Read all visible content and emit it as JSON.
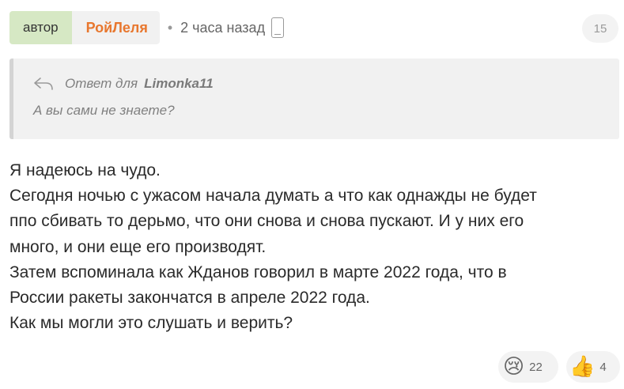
{
  "comment": {
    "author_tag": "автор",
    "author_name": "РойЛеля",
    "separator": "•",
    "time": "2 часа назад",
    "device_icon": "phone-icon",
    "rating": "15"
  },
  "quote": {
    "prefix": "Ответ для",
    "user": "Limonka11",
    "text": "А вы сами не знаете?",
    "icon": "reply-icon"
  },
  "body": {
    "lines": [
      "Я надеюсь на чудо.",
      "Сегодня ночью с ужасом начала думать а что как однажды не будет",
      "ппо сбивать то дерьмо, что они снова и снова пускают. И у них его",
      "много, и они еще его производят.",
      "Затем вспоминала как Жданов говорил в марте 2022 года, что в",
      "России ракеты закончатся в апреле 2022 года.",
      "Как мы могли это слушать и верить?"
    ]
  },
  "reactions": [
    {
      "emoji": "😢",
      "icon": "crying-face-icon",
      "count": "22"
    },
    {
      "emoji": "👍",
      "icon": "thumbs-up-icon",
      "count": "4"
    }
  ],
  "colors": {
    "author_name": "#e8772e",
    "author_tag_bg": "#d6e8c4",
    "quote_bg": "#f1f1f1"
  }
}
